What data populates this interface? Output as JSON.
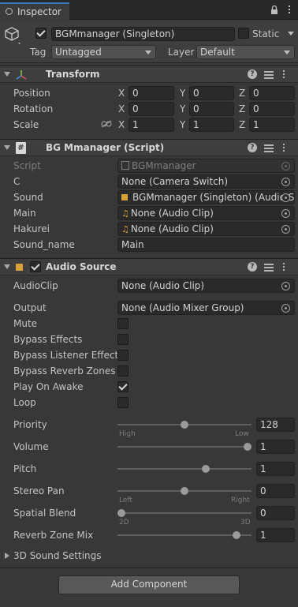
{
  "tab": {
    "title": "Inspector"
  },
  "gameobject": {
    "name": "BGMmanager (Singleton)",
    "static_label": "Static",
    "tag_label": "Tag",
    "tag_value": "Untagged",
    "layer_label": "Layer",
    "layer_value": "Default"
  },
  "transform": {
    "title": "Transform",
    "rows": [
      {
        "label": "Position",
        "x": "0",
        "y": "0",
        "z": "0"
      },
      {
        "label": "Rotation",
        "x": "0",
        "y": "0",
        "z": "0"
      },
      {
        "label": "Scale",
        "x": "1",
        "y": "1",
        "z": "1"
      }
    ],
    "axis": {
      "x": "X",
      "y": "Y",
      "z": "Z"
    }
  },
  "script": {
    "title": "BG Mmanager (Script)",
    "fields": [
      {
        "label": "Script",
        "value": "BGMmanager"
      },
      {
        "label": "C",
        "value": "None (Camera Switch)"
      },
      {
        "label": "Sound",
        "value": "BGMmanager (Singleton) (Audio S"
      },
      {
        "label": "Main",
        "value": "None (Audio Clip)"
      },
      {
        "label": "Hakurei",
        "value": "None (Audio Clip)"
      },
      {
        "label": "Sound_name",
        "value": "Main"
      }
    ]
  },
  "audio": {
    "title": "Audio Source",
    "audioclip_label": "AudioClip",
    "audioclip_value": "None (Audio Clip)",
    "output_label": "Output",
    "output_value": "None (Audio Mixer Group)",
    "toggles": [
      {
        "label": "Mute",
        "checked": false
      },
      {
        "label": "Bypass Effects",
        "checked": false
      },
      {
        "label": "Bypass Listener Effects",
        "checked": false
      },
      {
        "label": "Bypass Reverb Zones",
        "checked": false
      },
      {
        "label": "Play On Awake",
        "checked": true
      },
      {
        "label": "Loop",
        "checked": false
      }
    ],
    "sliders": [
      {
        "label": "Priority",
        "value": "128",
        "fraction": 0.5,
        "left": "High",
        "right": "Low"
      },
      {
        "label": "Volume",
        "value": "1",
        "fraction": 1.0
      },
      {
        "label": "Pitch",
        "value": "1",
        "fraction": 0.67
      },
      {
        "label": "Stereo Pan",
        "value": "0",
        "fraction": 0.5,
        "left": "Left",
        "right": "Right"
      },
      {
        "label": "Spatial Blend",
        "value": "0",
        "fraction": 0.0,
        "left": "2D",
        "right": "3D"
      },
      {
        "label": "Reverb Zone Mix",
        "value": "1",
        "fraction": 0.91
      }
    ],
    "sound_settings_label": "3D Sound Settings"
  },
  "add_component_label": "Add Component",
  "colors": {
    "accent": "#3a79bb",
    "bg": "#383838",
    "header": "#3e3e3e",
    "field": "#2a2a2a"
  }
}
